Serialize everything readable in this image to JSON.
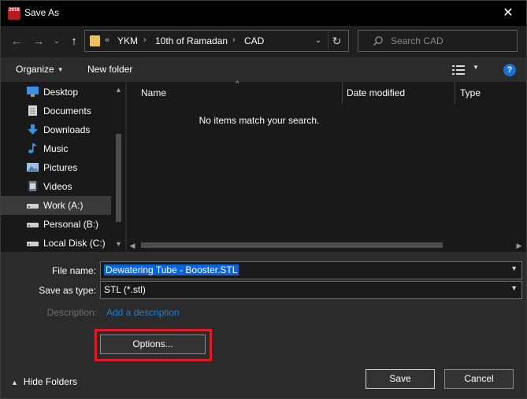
{
  "window": {
    "title": "Save As",
    "app_icon_text": "2016",
    "close_glyph": "✕"
  },
  "nav": {
    "back_glyph": "←",
    "forward_glyph": "→",
    "recent_glyph": "⌄",
    "up_glyph": "↑"
  },
  "address": {
    "overflow": "«",
    "crumbs": [
      "YKM",
      "10th of Ramadan",
      "CAD"
    ],
    "separator": "›",
    "chevron_glyph": "⌄",
    "refresh_glyph": "↻"
  },
  "search": {
    "placeholder": "Search CAD",
    "icon": "search-icon"
  },
  "toolbar": {
    "organize_label": "Organize",
    "new_folder_label": "New folder",
    "help_label": "?"
  },
  "navpane": {
    "items": [
      {
        "label": "Desktop",
        "icon": "desktop-icon",
        "color": "#3d8fe0"
      },
      {
        "label": "Documents",
        "icon": "documents-icon",
        "color": "#d8d8d8"
      },
      {
        "label": "Downloads",
        "icon": "downloads-icon",
        "color": "#3d8fe0"
      },
      {
        "label": "Music",
        "icon": "music-icon",
        "color": "#3d8fe0"
      },
      {
        "label": "Pictures",
        "icon": "pictures-icon",
        "color": "#9fc3e8"
      },
      {
        "label": "Videos",
        "icon": "videos-icon",
        "color": "#6e7b8a"
      },
      {
        "label": "Work (A:)",
        "icon": "drive-icon",
        "color": "#cfcfcf",
        "selected": true
      },
      {
        "label": "Personal (B:)",
        "icon": "drive-icon",
        "color": "#cfcfcf"
      },
      {
        "label": "Local Disk (C:)",
        "icon": "drive-icon",
        "color": "#cfcfcf"
      }
    ]
  },
  "list": {
    "columns": [
      "Name",
      "Date modified",
      "Type"
    ],
    "empty_message": "No items match your search."
  },
  "form": {
    "file_name_label": "File name:",
    "file_name_value": "Dewatering Tube - Booster.STL",
    "save_type_label": "Save as type:",
    "save_type_value": "STL (*.stl)",
    "description_label": "Description:",
    "description_link": "Add a description",
    "options_button": "Options...",
    "save_button": "Save",
    "cancel_button": "Cancel",
    "hide_folders_label": "Hide Folders"
  },
  "colors": {
    "accent": "#0a64d6",
    "highlight": "#e01b24",
    "link": "#1f7fd6"
  }
}
